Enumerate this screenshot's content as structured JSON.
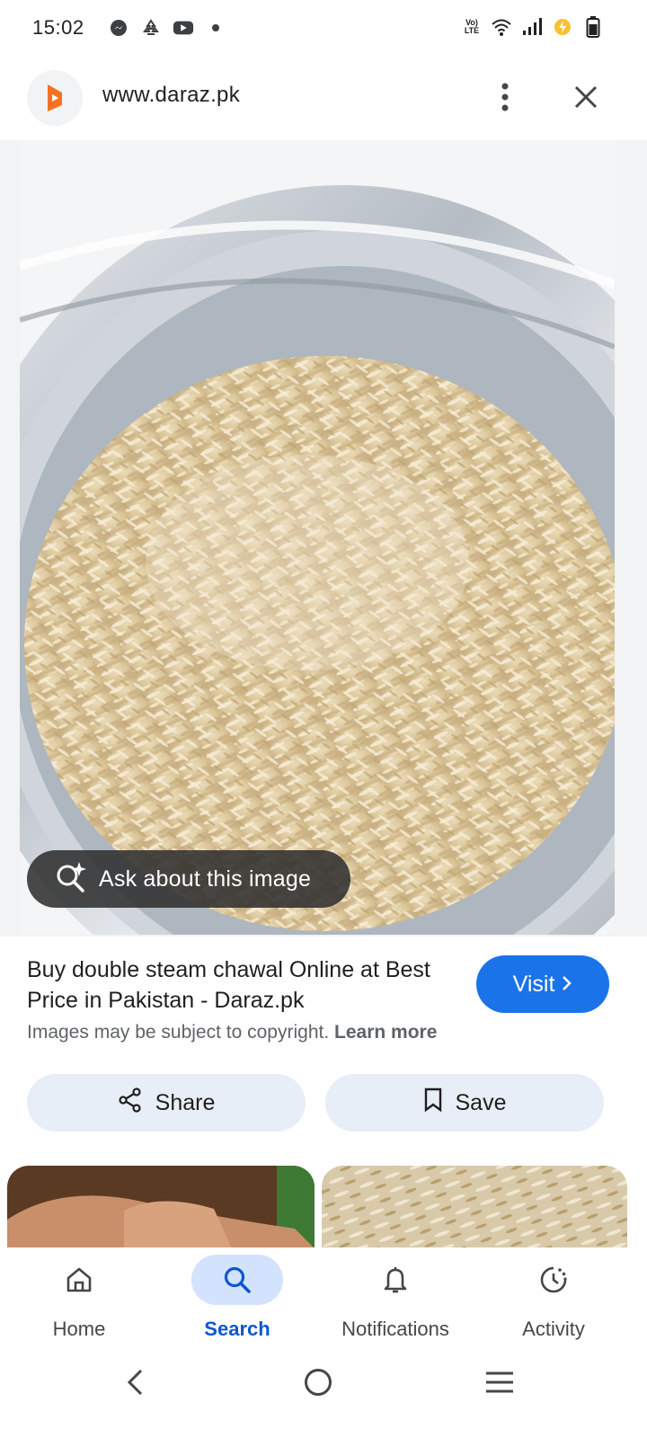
{
  "status_bar": {
    "time": "15:02",
    "left_icons": [
      "messenger-icon",
      "recycle-icon",
      "youtube-icon",
      "dot-icon"
    ],
    "volte_text": "Vo) LTE",
    "right_icons": [
      "wifi-icon",
      "signal-icon",
      "battery-saver-icon",
      "battery-icon"
    ]
  },
  "header": {
    "site_url": "www.daraz.pk",
    "logo_icon": "daraz-logo-icon",
    "more_icon": "more-vert-icon",
    "close_icon": "close-icon"
  },
  "viewer": {
    "image_description_icon": "rice-image",
    "ask_label": "Ask about this image"
  },
  "result": {
    "title": "Buy double steam chawal Online at Best Price in Pakistan - Daraz.pk",
    "visit_label": "Visit",
    "copyright_text": "Images may be subject to copyright.",
    "learn_more": "Learn more",
    "share_label": "Share",
    "save_label": "Save"
  },
  "bottom_nav": {
    "items": [
      {
        "label": "Home",
        "icon": "home-icon",
        "active": false
      },
      {
        "label": "Search",
        "icon": "search-icon",
        "active": true
      },
      {
        "label": "Notifications",
        "icon": "bell-icon",
        "active": false
      },
      {
        "label": "Activity",
        "icon": "activity-icon",
        "active": false
      }
    ]
  },
  "colors": {
    "accent": "#1a73e8",
    "active_nav_bg": "#d3e3fd",
    "pill_bg": "#e8eef8",
    "daraz_orange": "#f57224"
  }
}
